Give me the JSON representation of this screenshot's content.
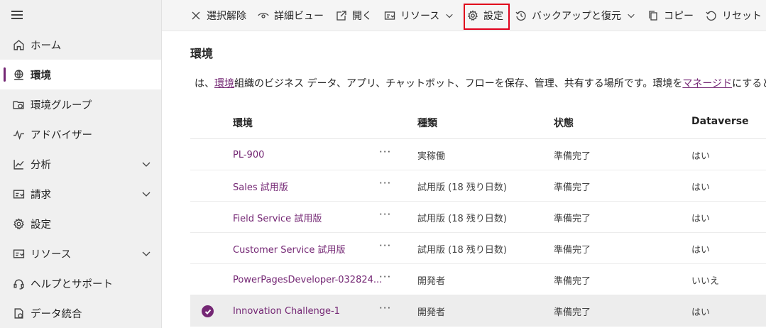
{
  "sidebar": {
    "items": [
      {
        "label": "ホーム",
        "icon": "home-icon"
      },
      {
        "label": "環境",
        "icon": "environment-icon"
      },
      {
        "label": "環境グループ",
        "icon": "environment-group-icon"
      },
      {
        "label": "アドバイザー",
        "icon": "advisor-icon"
      },
      {
        "label": "分析",
        "icon": "analytics-icon"
      },
      {
        "label": "請求",
        "icon": "billing-icon"
      },
      {
        "label": "設定",
        "icon": "settings-icon"
      },
      {
        "label": "リソース",
        "icon": "resources-icon"
      },
      {
        "label": "ヘルプとサポート",
        "icon": "help-support-icon"
      },
      {
        "label": "データ統合",
        "icon": "data-integration-icon"
      }
    ]
  },
  "toolbar": {
    "deselect": "選択解除",
    "detail_view": "詳細ビュー",
    "open": "開く",
    "resources": "リソース",
    "settings": "設定",
    "backup_restore": "バックアップと復元",
    "copy": "コピー",
    "reset": "リセット"
  },
  "main": {
    "title": "環境",
    "description_prefix": "は、",
    "description_link": "環境",
    "description_mid": "組織のビジネス データ、アプリ、チャットボット、フローを保存、管理、共有する場所です。環境を",
    "description_link2": "マネージド",
    "description_suffix": "にすると"
  },
  "table": {
    "columns": [
      "環境",
      "種類",
      "状態",
      "Dataverse"
    ],
    "rows": [
      {
        "name": "PL-900",
        "type": "実稼働",
        "state": "準備完了",
        "dataverse": "はい",
        "more": "···"
      },
      {
        "name": "Sales 試用版",
        "type": "試用版 (18 残り日数)",
        "state": "準備完了",
        "dataverse": "はい",
        "more": "···"
      },
      {
        "name": "Field Service 試用版",
        "type": "試用版 (18 残り日数)",
        "state": "準備完了",
        "dataverse": "はい",
        "more": "···"
      },
      {
        "name": "Customer Service 試用版",
        "type": "試用版 (18 残り日数)",
        "state": "準備完了",
        "dataverse": "はい",
        "more": "···"
      },
      {
        "name": "PowerPagesDeveloper-032824...",
        "type": "開発者",
        "state": "準備完了",
        "dataverse": "いいえ",
        "more": "···"
      },
      {
        "name": "Innovation Challenge-1",
        "type": "開発者",
        "state": "準備完了",
        "dataverse": "はい",
        "more": "···"
      }
    ]
  },
  "colors": {
    "accent": "#742774",
    "highlight": "#e0001b"
  }
}
